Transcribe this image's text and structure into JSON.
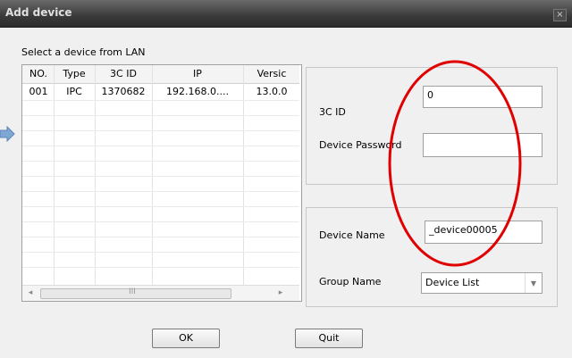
{
  "window": {
    "title": "Add device",
    "close_label": "×"
  },
  "lan": {
    "label": "Select a device from LAN",
    "columns": [
      "NO.",
      "Type",
      "3C ID",
      "IP",
      "Versic"
    ],
    "rows": [
      [
        "001",
        "IPC",
        "1370682",
        "192.168.0....",
        "13.0.0"
      ]
    ],
    "scroll_thumb_label": "III"
  },
  "form": {
    "id_label": "3C ID",
    "id_value": "0",
    "password_label": "Device Password",
    "password_value": "",
    "name_label": "Device Name",
    "name_value": "_device00005",
    "group_label": "Group Name",
    "group_value": "Device List"
  },
  "buttons": {
    "ok": "OK",
    "quit": "Quit"
  },
  "colors": {
    "annotation": "#e00000",
    "arrow": "#7fa7d4"
  }
}
